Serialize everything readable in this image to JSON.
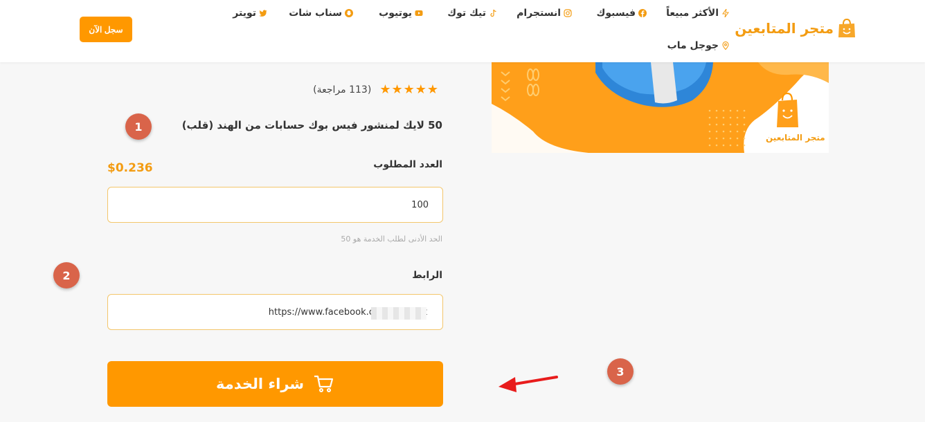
{
  "header": {
    "logo_text": "متجر المتابعين",
    "signup_label": "سجل الآن",
    "nav": [
      {
        "label": "الأكثر مبيعاً",
        "icon": "bolt-icon"
      },
      {
        "label": "فيسبوك",
        "icon": "facebook-icon"
      },
      {
        "label": "انستجرام",
        "icon": "instagram-icon"
      },
      {
        "label": "تيك توك",
        "icon": "tiktok-icon"
      },
      {
        "label": "يوتيوب",
        "icon": "youtube-icon"
      },
      {
        "label": "سناب شات",
        "icon": "snapchat-icon"
      },
      {
        "label": "تويتر",
        "icon": "twitter-icon"
      },
      {
        "label": "جوجل ماب",
        "icon": "map-pin-icon"
      }
    ]
  },
  "product": {
    "image_logo_text": "متجر المتابعين",
    "rating_stars": "★★★★★",
    "review_count": "(113 مراجعة)",
    "title": "50 لايك لمنشور فيس بوك حسابات من الهند (قلب)",
    "quantity_label": "العدد المطلوب",
    "price": "$0.236",
    "quantity_value": "100",
    "min_hint": "الحد الأدنى لطلب الخدمة هو 50",
    "link_label": "الرابط",
    "link_value": "https://www.facebook.c",
    "link_suffix": "t",
    "buy_label": "شراء الخدمة"
  },
  "annotations": {
    "badge_1": "1",
    "badge_2": "2",
    "badge_3": "3"
  },
  "colors": {
    "accent": "#ff9800",
    "badge": "#d9644a",
    "arrow": "#e81c1c"
  }
}
